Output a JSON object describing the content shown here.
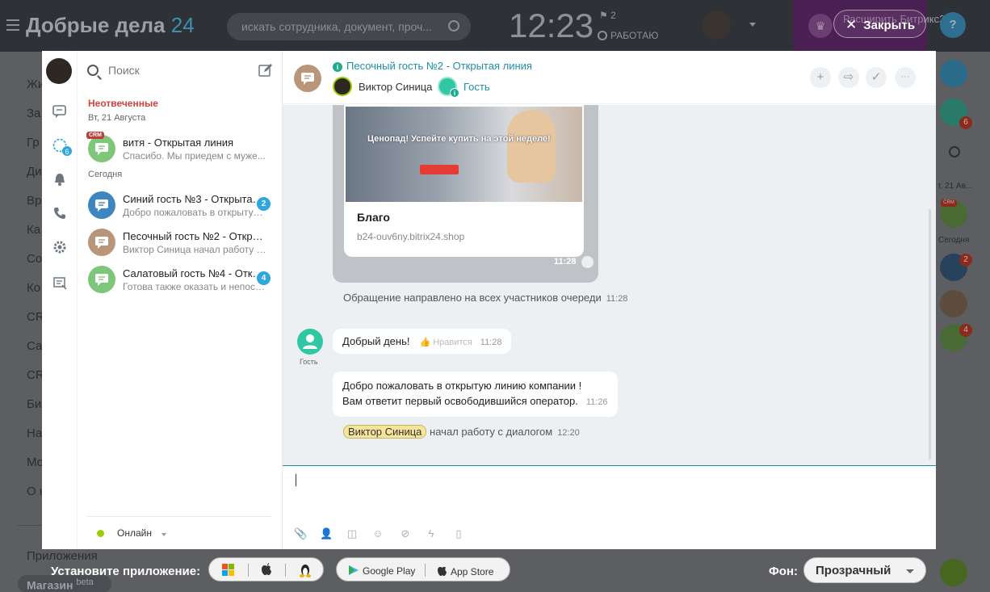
{
  "topbar": {
    "brand_name": "Добрые дела",
    "brand_num": "24",
    "search_placeholder": "искать сотрудника, документ, проч...",
    "clock": "12:23",
    "flag_count": "2",
    "work_status": "РАБОТАЮ",
    "expand_text": "Расширить Битрикс24",
    "help": "?",
    "close_label": "Закрыть"
  },
  "left_menu": {
    "items": [
      "Жи",
      "За",
      "Гр",
      "Ди",
      "Вр",
      "Ка",
      "Со",
      "Ко",
      "CR",
      "Са",
      "CR",
      "Би",
      "На",
      "Мо",
      "О к"
    ],
    "apps": "Приложения",
    "shop": "Магазин",
    "shop_sup": "beta"
  },
  "right_col": {
    "badge_openlines": "6",
    "date_label": "т, 21 Ав...",
    "crm": "CRM",
    "today": "Сегодня",
    "badge_blue": "2",
    "badge_green": "4"
  },
  "messenger": {
    "search_placeholder": "Поиск",
    "nav_badge": "6",
    "section_unanswered": "Неотвеченные",
    "date_old": "Вт, 21 Августа",
    "date_today": "Сегодня",
    "chats": [
      {
        "title": "витя - Открытая линия",
        "subtitle": "Спасибо. Мы приедем с муже...",
        "crm": "CRM",
        "color": "#7ec77a"
      },
      {
        "title": "Синий гость №3 - Открытая линия",
        "subtitle": "Добро пожаловать в открытую...",
        "count": "2",
        "color": "#3e86bf"
      },
      {
        "title": "Песочный гость №2 - Открытая линия",
        "subtitle": "Виктор Синица начал работу с диалогом",
        "color": "#b9957a"
      },
      {
        "title": "Салатовый гость №4 - Открытая линия",
        "subtitle": "Готова также оказать и непосредственно",
        "count": "4",
        "color": "#7ec77a"
      }
    ],
    "status": "Онлайн"
  },
  "chat": {
    "title": "Песочный гость №2 - Открытая линия",
    "user1": "Виктор Синица",
    "user2": "Гость",
    "head_buttons": [
      "+",
      "⇨",
      "✓",
      "···"
    ],
    "card": {
      "headline": "Ценопад! Успейте купить на этой неделе!",
      "name": "Благо",
      "url": "b24-ouv6ny.bitrix24.shop",
      "time": "11:28"
    },
    "sys_queue": {
      "text": "Обращение направлено на всех участников очереди",
      "time": "11:28"
    },
    "guest_label": "Гость",
    "msg1": {
      "text": "Добрый день!",
      "like": "Нравится",
      "time": "11:28"
    },
    "msg2": {
      "line1": "Добро пожаловать в открытую линию компании !",
      "line2": "Вам ответит первый освободившийся оператор.",
      "time": "11:26"
    },
    "sys_start": {
      "name": "Виктор Синица",
      "text": "начал работу с диалогом",
      "time": "12:20"
    }
  },
  "bottom": {
    "install_label": "Установите приложение:",
    "google_play": "Google Play",
    "app_store": "App Store",
    "bg_label": "Фон:",
    "bg_value": "Прозрачный"
  },
  "colors": {
    "accent": "#2fa6dc",
    "link": "#1d8fa6",
    "unanswered_red": "#d0443a",
    "online_green": "#9dcf00"
  }
}
